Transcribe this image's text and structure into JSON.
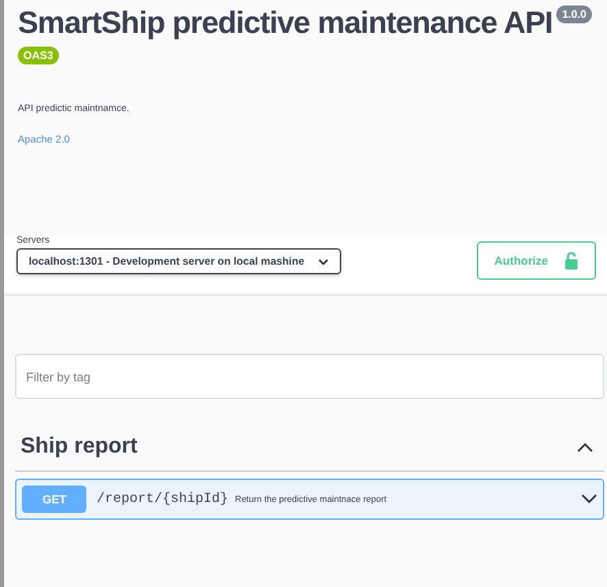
{
  "info": {
    "title": "SmartShip predictive maintenance API",
    "version": "1.0.0",
    "spec_badge": "OAS3",
    "description": "API predictic maintnamce.",
    "license": "Apache 2.0"
  },
  "servers": {
    "label": "Servers",
    "selected": "localhost:1301 - Development server on local mashine"
  },
  "authorize": {
    "label": "Authorize"
  },
  "filter": {
    "placeholder": "Filter by tag"
  },
  "tags": [
    {
      "name": "Ship report",
      "expanded": true,
      "operations": [
        {
          "method": "GET",
          "path": "/report/{shipId}",
          "summary": "Return the predictive maintnace report",
          "expanded": false
        }
      ]
    }
  ]
}
